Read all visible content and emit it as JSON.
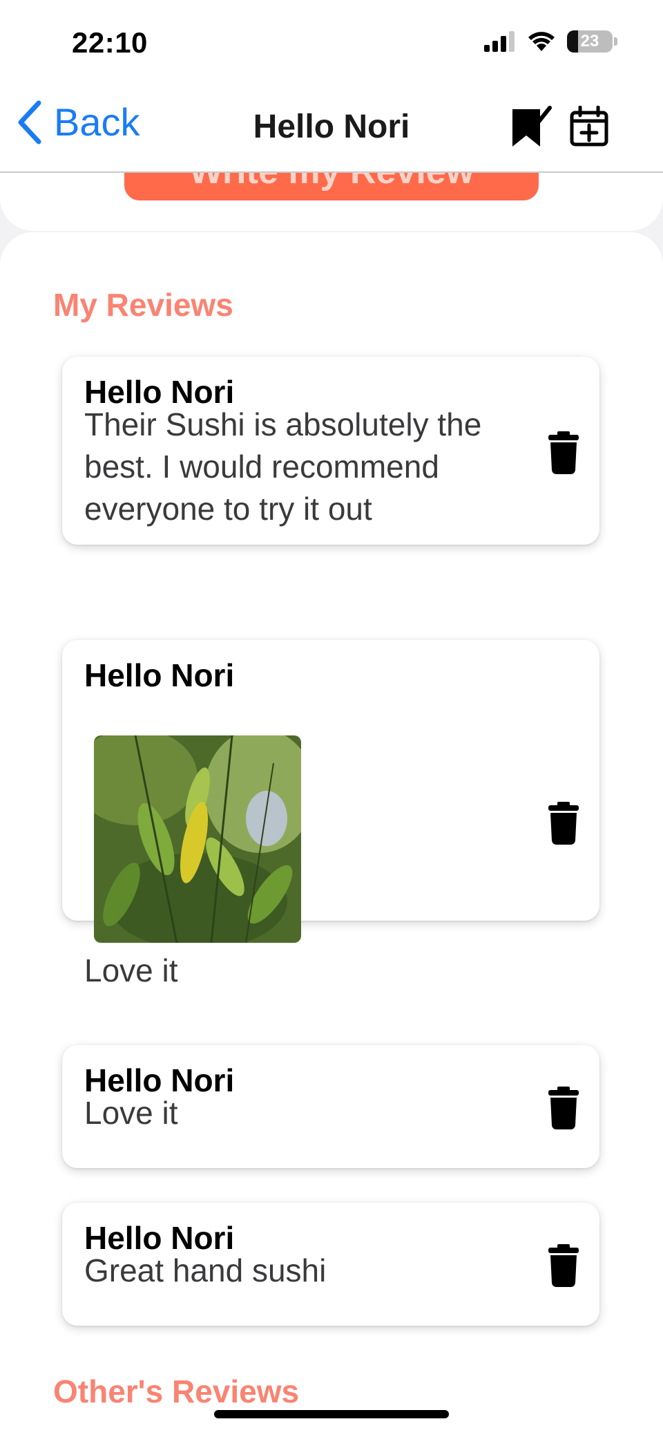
{
  "status_bar": {
    "time": "22:10",
    "battery": "23"
  },
  "nav": {
    "back_label": "Back",
    "title": "Hello Nori"
  },
  "write_button_label": "Write my Review",
  "sections": {
    "my_reviews": "My Reviews",
    "others_reviews": "Other's Reviews"
  },
  "reviews": [
    {
      "name": "Hello Nori",
      "text": "Their Sushi is absolutely the best. I would recommend everyone to try it out"
    },
    {
      "name": "Hello Nori",
      "text": "Love it",
      "has_photo": true
    },
    {
      "name": "Hello Nori",
      "text": "Love it"
    },
    {
      "name": "Hello Nori",
      "text": "Great hand sushi"
    }
  ],
  "colors": {
    "accent_blue": "#1a7cf5",
    "accent_orange": "#ff6a4a",
    "section_title": "#fa8372"
  }
}
